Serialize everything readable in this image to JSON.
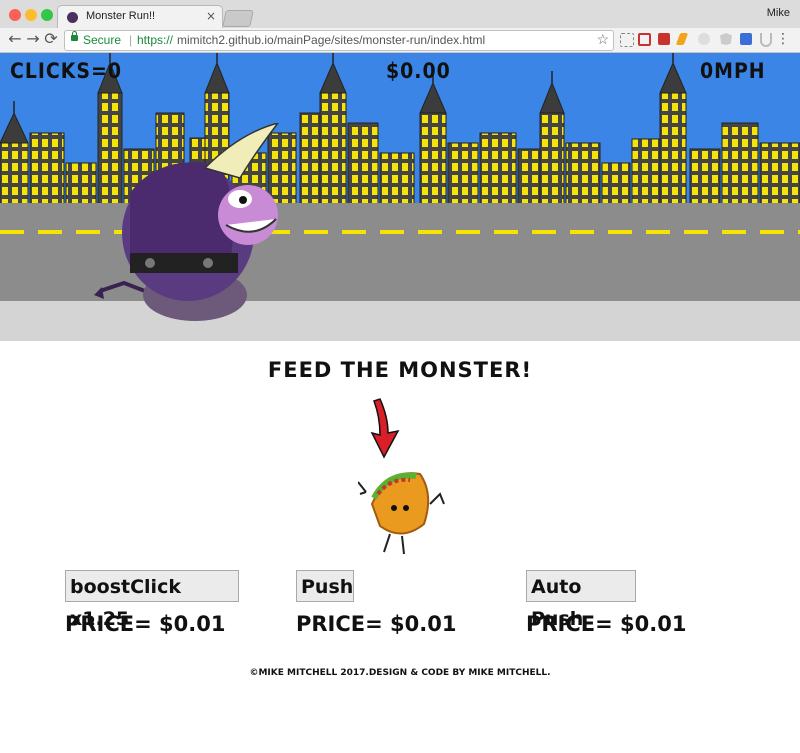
{
  "browser": {
    "tab_title": "Monster Run!!",
    "tab_close": "×",
    "profile_name": "Mike",
    "secure_label": "Secure",
    "url_protocol": "https://",
    "url_rest": "mimitch2.github.io/mainPage/sites/monster-run/index.html",
    "back_glyph": "←",
    "forward_glyph": "→",
    "reload_glyph": "⟳",
    "star_glyph": "☆",
    "menu_glyph": "⋮"
  },
  "game": {
    "clicks_label": "CLICKS=0",
    "money_label": "$0.00",
    "speed_label": "0MPH"
  },
  "feed": {
    "heading": "FEED THE MONSTER!"
  },
  "shop": {
    "items": [
      {
        "button": "boostClick x1.25",
        "price": "PRICE= $0.01"
      },
      {
        "button": "Push",
        "price": "PRICE= $0.01"
      },
      {
        "button": "Auto Push",
        "price": "PRICE= $0.01"
      }
    ]
  },
  "footer": {
    "text": "©MIKE MITCHELL 2017.DESIGN & CODE BY MIKE MITCHELL."
  },
  "colors": {
    "sky": "#3a85e6",
    "building": "#4a4a4a",
    "window": "#f5e40a",
    "road": "#8c8c8c",
    "lane": "#f7e300",
    "monster": "#5a3a80"
  }
}
